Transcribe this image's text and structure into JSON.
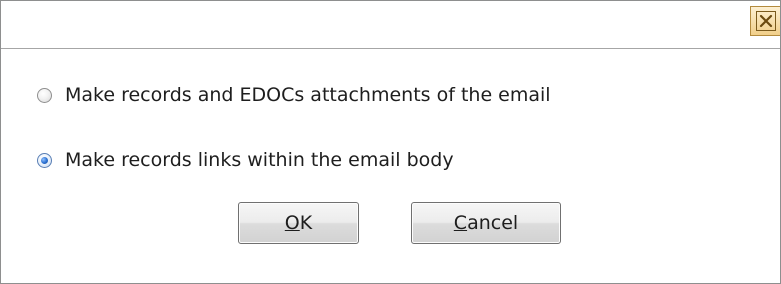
{
  "titlebar": {
    "close_icon": "close-icon"
  },
  "options": [
    {
      "label": "Make records and EDOCs attachments of the email",
      "checked": false
    },
    {
      "label": "Make records links within the email body",
      "checked": true
    }
  ],
  "buttons": {
    "ok": {
      "mnemonic": "O",
      "rest": "K"
    },
    "cancel": {
      "mnemonic": "C",
      "rest": "ancel"
    }
  },
  "colors": {
    "close_button": "#f1cf8a",
    "radio_selected": "#2a6fd0",
    "border": "#8e8f8f"
  }
}
